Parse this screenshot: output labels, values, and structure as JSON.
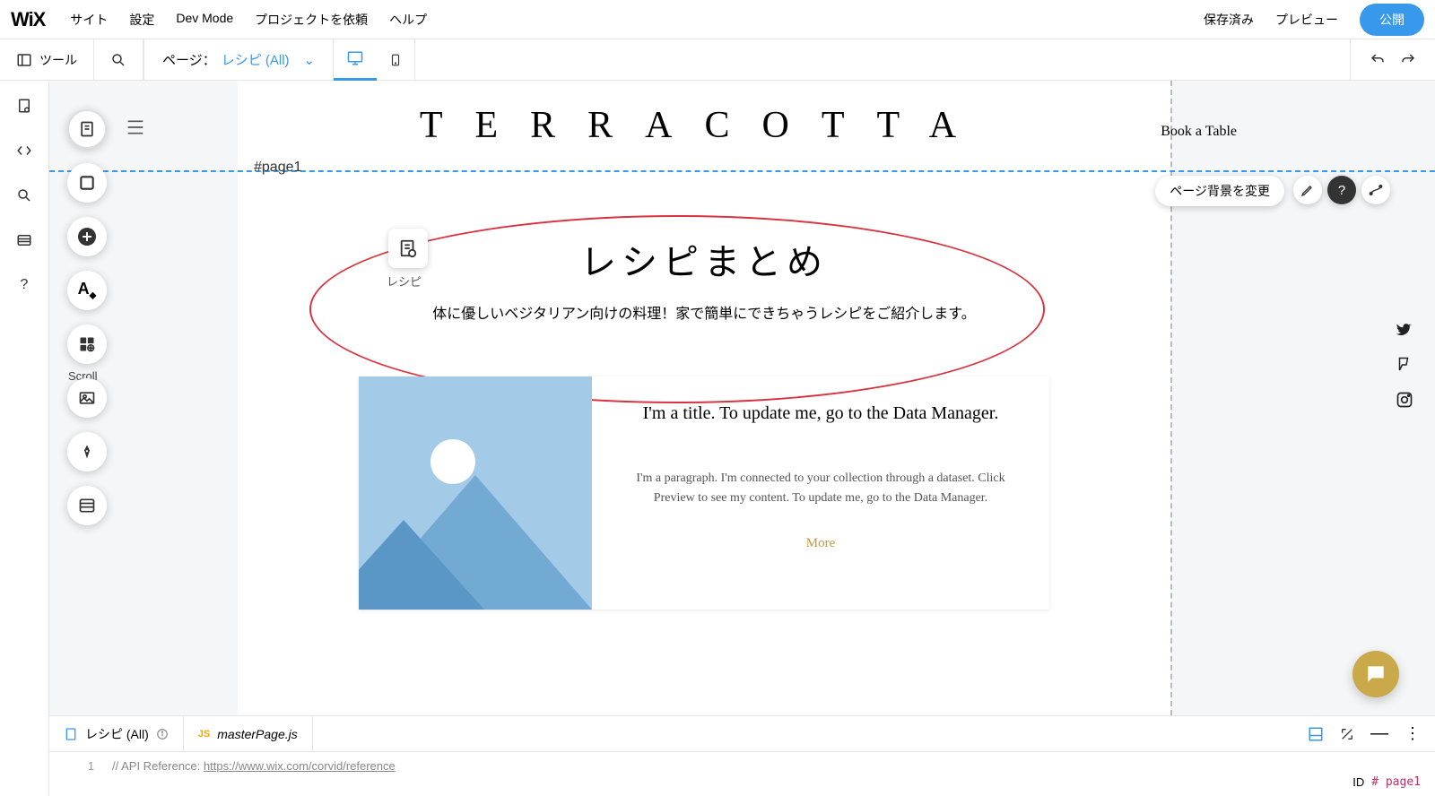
{
  "top": {
    "logo": "WiX",
    "menu": [
      "サイト",
      "設定",
      "Dev Mode",
      "プロジェクトを依頼",
      "ヘルプ"
    ],
    "saved": "保存済み",
    "preview": "プレビュー",
    "publish": "公開"
  },
  "toolbar": {
    "tools": "ツール",
    "page_prefix": "ページ：",
    "page_name": "レシピ (All)"
  },
  "canvas": {
    "page_anchor": "#page1",
    "site_title": "TERRACOTTA",
    "book_table": "Book a Table",
    "change_bg": "ページ背景を変更",
    "scroll_label": "Scroll",
    "hero": {
      "dataset_label": "レシピ",
      "title": "レシピまとめ",
      "desc": "体に優しいベジタリアン向けの料理！家で簡単にできちゃうレシピをご紹介します。"
    },
    "card": {
      "title": "I'm a title. To update me, go to the Data Manager.",
      "para": "I'm a paragraph. I'm connected to your collection through a dataset. Click Preview to see my content. To update me, go to the Data Manager.",
      "more": "More"
    }
  },
  "code_panel": {
    "tab1": "レシピ (All)",
    "tab2": "masterPage.js",
    "line_no": "1",
    "comment": "// API Reference: ",
    "url": "https://www.wix.com/corvid/reference",
    "id_label": "ID",
    "id_value": "# page1"
  }
}
